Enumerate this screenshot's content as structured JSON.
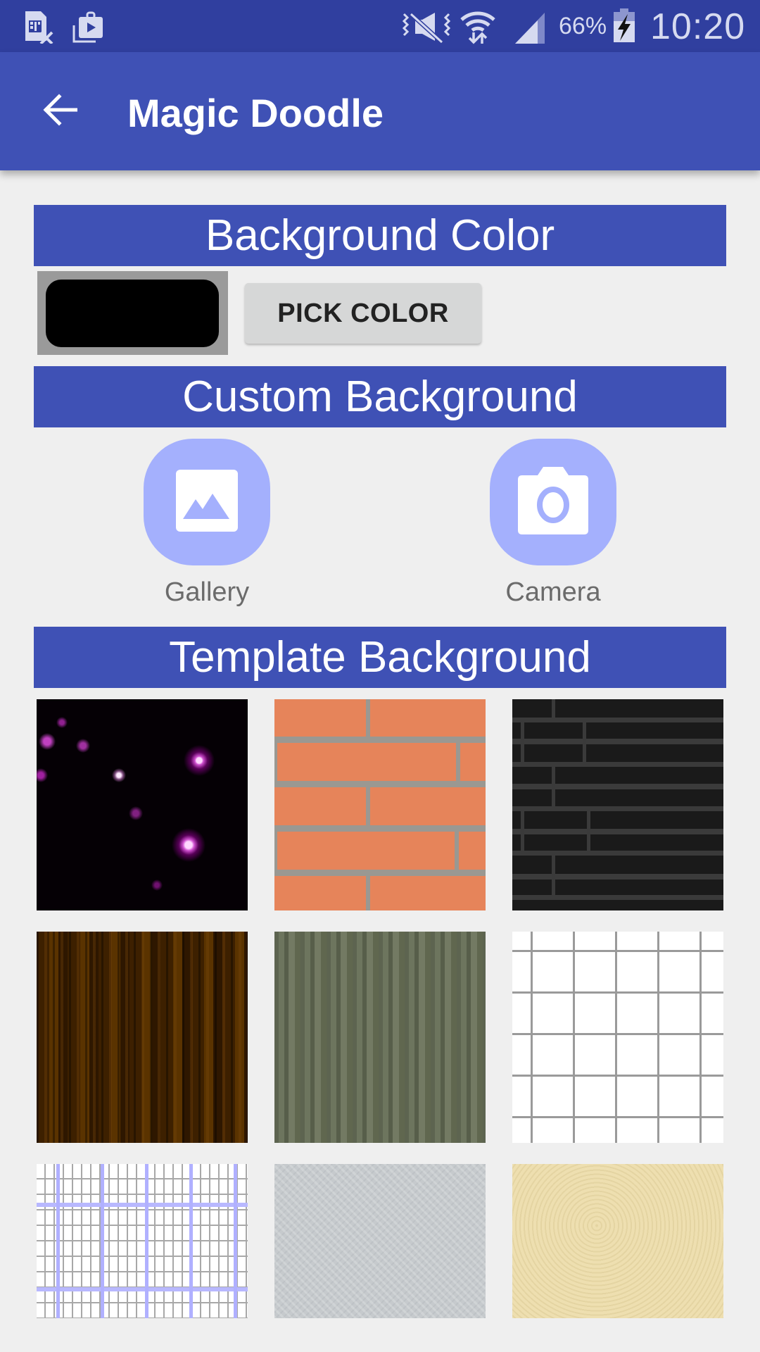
{
  "status_bar": {
    "left_icons": [
      "no-sim-icon",
      "play-store-update-icon"
    ],
    "right_icons": [
      "vibrate-mute-icon",
      "wifi-data-icon",
      "cell-signal-icon",
      "battery-charging-icon"
    ],
    "battery_percent": "66%",
    "time": "10:20"
  },
  "app_bar": {
    "back_icon": "arrow-back-icon",
    "title": "Magic Doodle"
  },
  "sections": {
    "background_color": {
      "title": "Background Color",
      "current_color": "#000000",
      "pick_button": "PICK COLOR"
    },
    "custom_background": {
      "title": "Custom Background",
      "options": [
        {
          "label": "Gallery",
          "icon": "image-icon"
        },
        {
          "label": "Camera",
          "icon": "camera-icon"
        }
      ]
    },
    "template_background": {
      "title": "Template Background",
      "templates": [
        {
          "name": "purple-stars"
        },
        {
          "name": "orange-brick"
        },
        {
          "name": "black-brick"
        },
        {
          "name": "dark-wood"
        },
        {
          "name": "green-stripes"
        },
        {
          "name": "grid-paper"
        },
        {
          "name": "graph-paper"
        },
        {
          "name": "gray-concrete"
        },
        {
          "name": "sand-paper"
        }
      ]
    }
  },
  "colors": {
    "primary": "#3F51B5",
    "primary_dark": "#303F9F",
    "icon_button_bg": "#A4B0FD",
    "background": "#EFEFEF"
  }
}
